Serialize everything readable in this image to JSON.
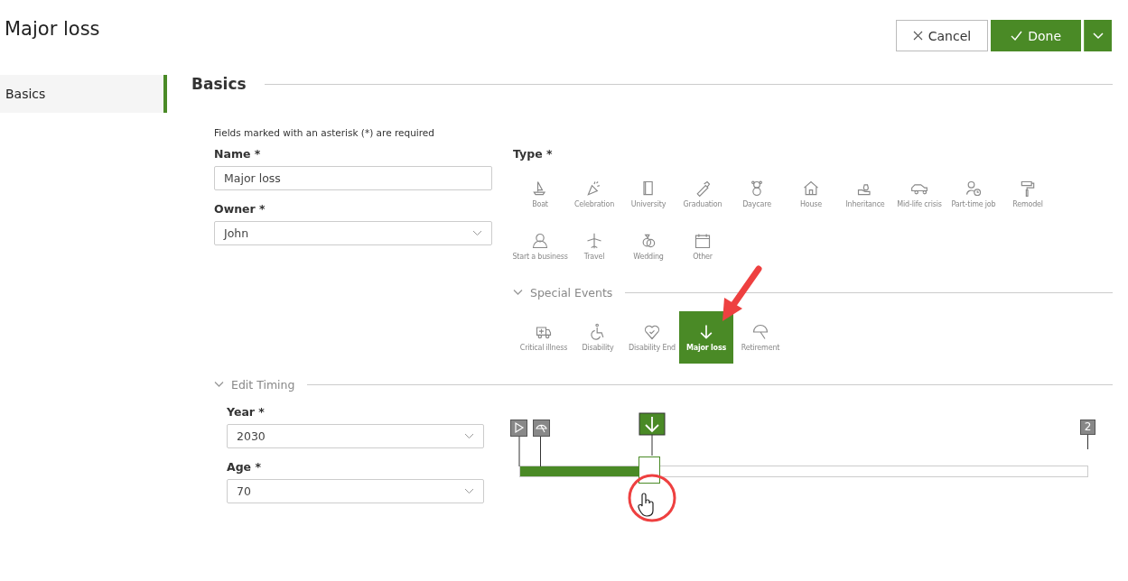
{
  "page": {
    "title": "Major loss"
  },
  "actions": {
    "cancel": "Cancel",
    "done": "Done"
  },
  "sidebar": {
    "items": [
      {
        "label": "Basics",
        "selected": true
      }
    ]
  },
  "section": {
    "title": "Basics",
    "note": "Fields marked with an asterisk (*) are required"
  },
  "form": {
    "name_label": "Name *",
    "name_value": "Major loss",
    "owner_label": "Owner *",
    "owner_value": "John"
  },
  "type": {
    "label": "Type *",
    "options": [
      {
        "label": "Boat",
        "selected": false
      },
      {
        "label": "Celebration",
        "selected": false
      },
      {
        "label": "University",
        "selected": false
      },
      {
        "label": "Graduation",
        "selected": false
      },
      {
        "label": "Daycare",
        "selected": false
      },
      {
        "label": "House",
        "selected": false
      },
      {
        "label": "Inheritance",
        "selected": false
      },
      {
        "label": "Mid-life crisis",
        "selected": false
      },
      {
        "label": "Part-time job",
        "selected": false
      },
      {
        "label": "Remodel",
        "selected": false
      },
      {
        "label": "Start a business",
        "selected": false
      },
      {
        "label": "Travel",
        "selected": false
      },
      {
        "label": "Wedding",
        "selected": false
      },
      {
        "label": "Other",
        "selected": false
      }
    ]
  },
  "special_events": {
    "title": "Special Events",
    "expanded": true,
    "options": [
      {
        "label": "Critical illness",
        "selected": false
      },
      {
        "label": "Disability",
        "selected": false
      },
      {
        "label": "Disability End",
        "selected": false
      },
      {
        "label": "Major loss",
        "selected": true
      },
      {
        "label": "Retirement",
        "selected": false
      }
    ]
  },
  "timing": {
    "title": "Edit Timing",
    "expanded": true,
    "year_label": "Year *",
    "year_value": "2030",
    "age_label": "Age *",
    "age_value": "70",
    "level": 0.21,
    "count": "2"
  }
}
